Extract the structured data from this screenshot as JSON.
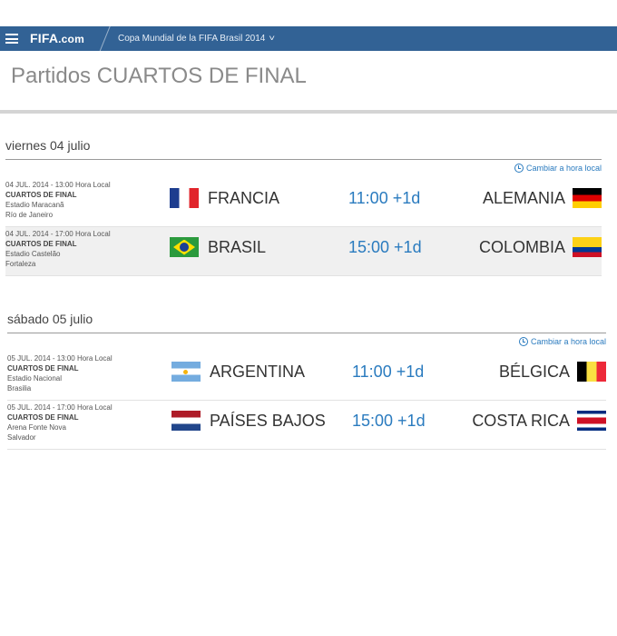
{
  "header": {
    "logo_main": "FIFA",
    "logo_suffix": ".com",
    "tournament": "Copa Mundial de la FIFA Brasil 2014"
  },
  "page": {
    "title_prefix": "Partidos",
    "title_stage": "CUARTOS DE FINAL"
  },
  "days": [
    {
      "heading": "viernes 04 julio",
      "change_time_label": "Cambiar a hora local",
      "matches": [
        {
          "datetime": "04 JUL. 2014 - 13:00 Hora Local",
          "stage": "CUARTOS DE FINAL",
          "stadium": "Estadio Maracanã",
          "city": "Río de Janeiro",
          "home": "FRANCIA",
          "home_flag": "france-flag-icon",
          "time": "11:00 +1d",
          "away": "ALEMANIA",
          "away_flag": "germany-flag-icon"
        },
        {
          "datetime": "04 JUL. 2014 - 17:00 Hora Local",
          "stage": "CUARTOS DE FINAL",
          "stadium": "Estadio Castelão",
          "city": "Fortaleza",
          "home": "BRASIL",
          "home_flag": "brazil-flag-icon",
          "time": "15:00 +1d",
          "away": "COLOMBIA",
          "away_flag": "colombia-flag-icon"
        }
      ]
    },
    {
      "heading": "sábado 05 julio",
      "change_time_label": "Cambiar a hora local",
      "matches": [
        {
          "datetime": "05 JUL. 2014 - 13:00 Hora Local",
          "stage": "CUARTOS DE FINAL",
          "stadium": "Estadio Nacional",
          "city": "Brasilia",
          "home": "ARGENTINA",
          "home_flag": "argentina-flag-icon",
          "time": "11:00 +1d",
          "away": "BÉLGICA",
          "away_flag": "belgium-flag-icon"
        },
        {
          "datetime": "05 JUL. 2014 - 17:00 Hora Local",
          "stage": "CUARTOS DE FINAL",
          "stadium": "Arena Fonte Nova",
          "city": "Salvador",
          "home": "PAÍSES BAJOS",
          "home_flag": "netherlands-flag-icon",
          "time": "15:00 +1d",
          "away": "COSTA RICA",
          "away_flag": "costa-rica-flag-icon"
        }
      ]
    }
  ],
  "colors": {
    "header_bar": "#326295",
    "accent_link": "#2a7bbf",
    "title_gray": "#8a8a8a"
  }
}
